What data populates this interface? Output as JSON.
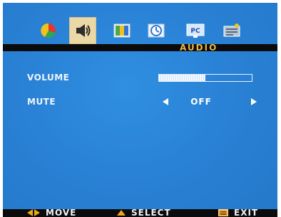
{
  "menu": {
    "tabs": [
      {
        "id": "picture",
        "icon": "color-wheel-icon",
        "active": false
      },
      {
        "id": "audio",
        "icon": "speaker-icon",
        "active": true
      },
      {
        "id": "display",
        "icon": "screen-icon",
        "active": false
      },
      {
        "id": "time",
        "icon": "clock-icon",
        "active": false
      },
      {
        "id": "pc",
        "icon": "pc-monitor-icon",
        "active": false
      },
      {
        "id": "setup",
        "icon": "settings-icon",
        "active": false
      }
    ],
    "title": "AUDIO"
  },
  "settings": {
    "volume": {
      "label": "VOLUME",
      "level": 0.5
    },
    "mute": {
      "label": "MUTE",
      "value": "OFF"
    }
  },
  "footer": {
    "move": "MOVE",
    "select": "SELECT",
    "exit": "EXIT"
  },
  "colors": {
    "background": "#2a82d6",
    "title_text": "#f2b43a",
    "bar": "#0b0b0b",
    "active_tab": "#ead8a6",
    "accent": "#f0a41b"
  }
}
